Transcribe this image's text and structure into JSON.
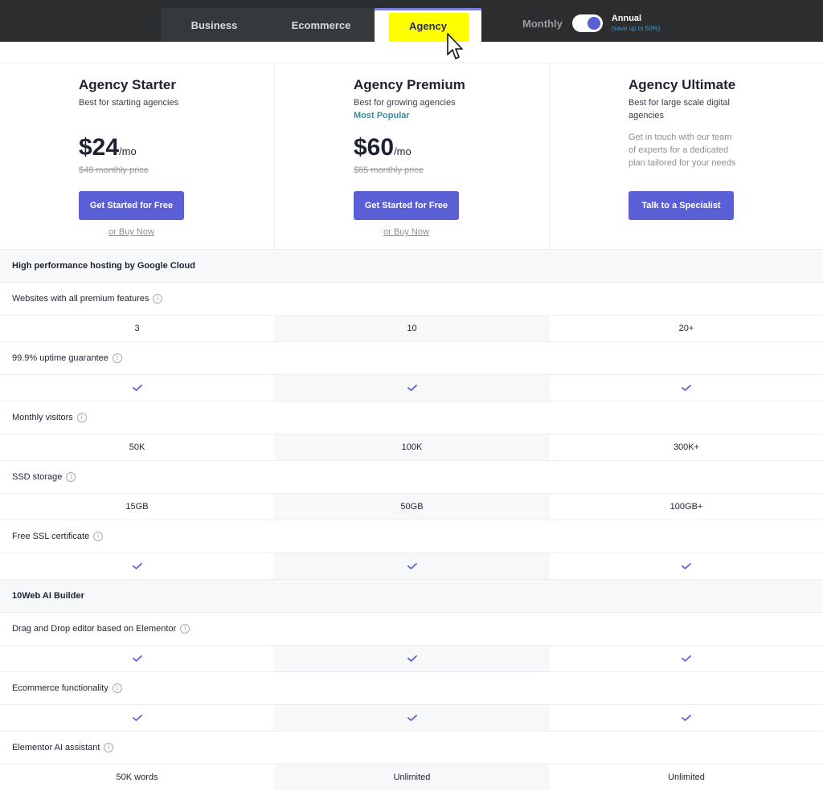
{
  "tabs": [
    {
      "label": "Business"
    },
    {
      "label": "Ecommerce"
    },
    {
      "label": "Agency"
    }
  ],
  "billing": {
    "monthly_label": "Monthly",
    "annual_label": "Annual",
    "annual_note": "(save up to 50%)",
    "annual_selected": true
  },
  "plans": [
    {
      "name": "Agency Starter",
      "subtitle": "Best for starting agencies",
      "price": "$24",
      "period": "/mo",
      "old_price": "$48 monthly price",
      "button": "Get Started for Free",
      "secondary_link": "or Buy Now"
    },
    {
      "name": "Agency Premium",
      "subtitle": "Best for growing agencies",
      "badge": "Most Popular",
      "price": "$60",
      "period": "/mo",
      "old_price": "$85 monthly price",
      "button": "Get Started for Free",
      "secondary_link": "or Buy Now"
    },
    {
      "name": "Agency Ultimate",
      "subtitle": "Best for large scale digital agencies",
      "contact_text": "Get in touch with our team of experts for a dedicated plan tailored for your needs",
      "button": "Talk to a Specialist"
    }
  ],
  "sections": [
    {
      "title": "High performance hosting by Google Cloud",
      "features": [
        {
          "label": "Websites with all premium features",
          "values": [
            "3",
            "10",
            "20+"
          ]
        },
        {
          "label": "99.9% uptime guarantee",
          "values": [
            "check",
            "check",
            "check"
          ]
        },
        {
          "label": "Monthly visitors",
          "values": [
            "50K",
            "100K",
            "300K+"
          ]
        },
        {
          "label": "SSD storage",
          "values": [
            "15GB",
            "50GB",
            "100GB+"
          ]
        },
        {
          "label": "Free SSL certificate",
          "values": [
            "check",
            "check",
            "check"
          ]
        }
      ]
    },
    {
      "title": "10Web AI Builder",
      "features": [
        {
          "label": "Drag and Drop editor based on Elementor",
          "values": [
            "check",
            "check",
            "check"
          ]
        },
        {
          "label": "Ecommerce functionality",
          "values": [
            "check",
            "check",
            "check"
          ]
        },
        {
          "label": "Elementor AI assistant",
          "values": [
            "50K words",
            "Unlimited",
            "Unlimited"
          ]
        }
      ]
    }
  ],
  "colors": {
    "topbar": "#2b2d2f",
    "accent": "#5a5fd6",
    "highlight": "#ffff00",
    "popular": "#3a8c9e"
  }
}
